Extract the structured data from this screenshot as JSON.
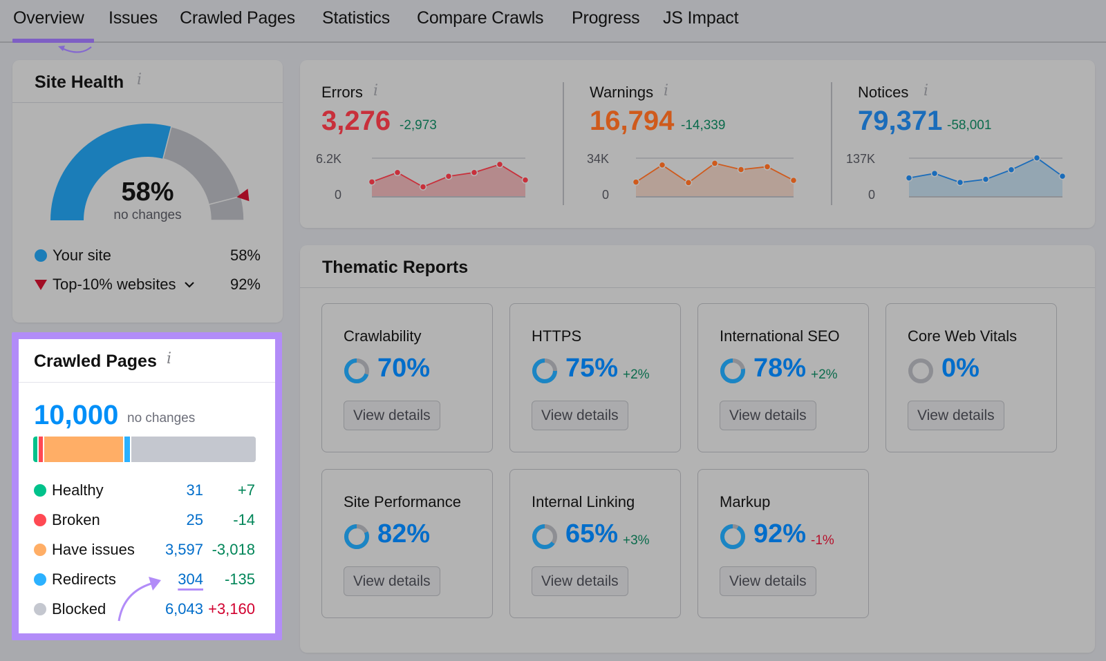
{
  "tabs": [
    {
      "label": "Overview",
      "active": true
    },
    {
      "label": "Issues"
    },
    {
      "label": "Crawled Pages"
    },
    {
      "label": "Statistics"
    },
    {
      "label": "Compare Crawls"
    },
    {
      "label": "Progress"
    },
    {
      "label": "JS Impact"
    }
  ],
  "site_health": {
    "title": "Site Health",
    "info_icon": "i",
    "score": "58%",
    "score_value": 58,
    "top10_value": 92,
    "score_sub": "no changes",
    "legend": [
      {
        "label": "Your site",
        "value": "58%",
        "color": "#1b7db8"
      },
      {
        "label": "Top-10% websites",
        "value": "92%",
        "color": "#a10d24"
      }
    ]
  },
  "crawled_pages": {
    "title": "Crawled Pages",
    "info_icon": "i",
    "total": "10,000",
    "total_sub": "no changes",
    "rows": [
      {
        "label": "Healthy",
        "count": "31",
        "change": "+7",
        "change_type": "good",
        "color": "#00c28b",
        "value": 31
      },
      {
        "label": "Broken",
        "count": "25",
        "change": "-14",
        "change_type": "good",
        "color": "#ff4953",
        "value": 25
      },
      {
        "label": "Have issues",
        "count": "3,597",
        "change": "-3,018",
        "change_type": "good",
        "color": "#ffae66",
        "value": 3597
      },
      {
        "label": "Redirects",
        "count": "304",
        "change": "-135",
        "change_type": "good",
        "color": "#2bb1ff",
        "value": 304
      },
      {
        "label": "Blocked",
        "count": "6,043",
        "change": "+3,160",
        "change_type": "bad",
        "color": "#c4c7cf",
        "value": 6043
      }
    ]
  },
  "issues": [
    {
      "label": "Errors",
      "value": "3,276",
      "delta": "-2,973",
      "color": "#c8303b",
      "axis_max": "6.2K",
      "axis_min": "0",
      "max": 6200,
      "trend": [
        2400,
        3900,
        1600,
        3300,
        3900,
        5200,
        2700
      ]
    },
    {
      "label": "Warnings",
      "value": "16,794",
      "delta": "-14,339",
      "color": "#cf5a1c",
      "axis_max": "34K",
      "axis_min": "0",
      "max": 34000,
      "trend": [
        13000,
        28000,
        12500,
        29500,
        24000,
        26500,
        14500
      ]
    },
    {
      "label": "Notices",
      "value": "79,371",
      "delta": "-58,001",
      "color": "#1a6cba",
      "axis_max": "137K",
      "axis_min": "0",
      "max": 137000,
      "trend": [
        67000,
        83000,
        51000,
        62000,
        96000,
        138000,
        73000
      ]
    }
  ],
  "thematic": {
    "title": "Thematic Reports",
    "cards": [
      {
        "title": "Crawlability",
        "pct": "70%",
        "value": 70,
        "delta": "",
        "delta_type": "",
        "button": "View details"
      },
      {
        "title": "HTTPS",
        "pct": "75%",
        "value": 75,
        "delta": "+2%",
        "delta_type": "good",
        "button": "View details"
      },
      {
        "title": "International SEO",
        "pct": "78%",
        "value": 78,
        "delta": "+2%",
        "delta_type": "good",
        "button": "View details"
      },
      {
        "title": "Core Web Vitals",
        "pct": "0%",
        "value": 0,
        "delta": "",
        "delta_type": "",
        "button": "View details"
      },
      {
        "title": "Site Performance",
        "pct": "82%",
        "value": 82,
        "delta": "",
        "delta_type": "",
        "button": "View details"
      },
      {
        "title": "Internal Linking",
        "pct": "65%",
        "value": 65,
        "delta": "+3%",
        "delta_type": "good",
        "button": "View details"
      },
      {
        "title": "Markup",
        "pct": "92%",
        "value": 92,
        "delta": "-1%",
        "delta_type": "bad",
        "button": "View details"
      }
    ]
  },
  "colors": {
    "accent_purple": "#b28cf8",
    "tab_active": "#7e5fc4",
    "link_blue": "#006dca",
    "good": "#008558",
    "bad": "#d1002f"
  }
}
